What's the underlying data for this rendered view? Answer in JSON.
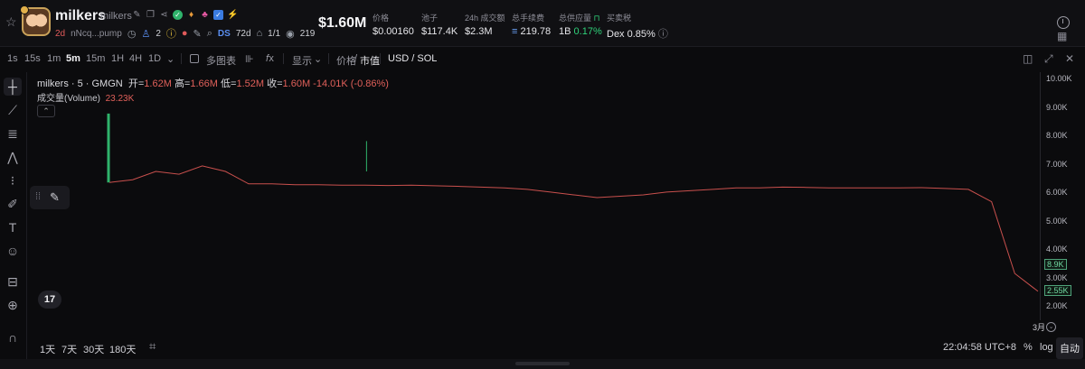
{
  "header": {
    "token_name": "milkers",
    "symbol": "milkers",
    "age": "2d",
    "creator": "nNcq...pump",
    "holders": "2",
    "ds_label": "DS",
    "ds_value": "72d",
    "ratio": "1/1",
    "views": "219",
    "market_cap": "$1.60M",
    "stats": [
      {
        "label": "价格",
        "value": "$0.00160"
      },
      {
        "label": "池子",
        "value": "$117.4K"
      },
      {
        "label": "24h 成交额",
        "value": "$2.3M"
      },
      {
        "label": "总手续费",
        "value": "219.78"
      },
      {
        "label": "总供应量",
        "value": "1B",
        "extra": "0.17%"
      },
      {
        "label": "买卖税",
        "value": "Dex 0.85%"
      }
    ]
  },
  "toolbar": {
    "intervals": [
      "1s",
      "15s",
      "1m",
      "5m",
      "15m",
      "1H",
      "4H",
      "1D"
    ],
    "active_interval": "5m",
    "multi_chart": "多图表",
    "display": "显示",
    "price_label": "价格",
    "slash": "/",
    "mcap_label": "市值",
    "currency": "USD / SOL"
  },
  "chart": {
    "legend_title": "milkers · 5 · GMGN",
    "open_label": "开=",
    "open": "1.62M",
    "high_label": "高=",
    "high": "1.66M",
    "low_label": "低=",
    "low": "1.52M",
    "close_label": "收=",
    "close": "1.60M",
    "change": "-14.01K (-0.86%)",
    "volume_label": "成交量(Volume)",
    "volume": "23.23K",
    "tv_logo": "17",
    "date_label": "3月"
  },
  "chart_data": {
    "type": "line",
    "ylim": [
      1500000,
      10500000
    ],
    "y_ticks": [
      "10.00K",
      "9.00K",
      "8.00K",
      "7.00K",
      "6.00K",
      "5.00K",
      "4.00K",
      "3.00K",
      "2.00K"
    ],
    "price_tags": [
      "8.9K",
      "2.55K"
    ],
    "x": [
      0,
      1,
      2,
      3,
      4,
      5,
      6,
      7,
      8,
      9,
      10,
      11,
      12,
      13,
      14,
      15,
      16,
      17,
      18,
      19,
      20,
      21,
      22,
      23,
      24,
      25,
      26,
      27,
      28,
      29,
      30,
      31,
      32,
      33,
      34,
      35,
      36,
      37,
      38,
      39,
      40
    ],
    "series": [
      {
        "values": [
          6500000,
          6600000,
          6900000,
          6800000,
          7100000,
          6900000,
          6450000,
          6450000,
          6420000,
          6420000,
          6400000,
          6400000,
          6390000,
          6400000,
          6380000,
          6360000,
          6330000,
          6300000,
          6250000,
          6150000,
          6050000,
          5950000,
          6000000,
          6050000,
          6150000,
          6200000,
          6250000,
          6300000,
          6300000,
          6330000,
          6320000,
          6300000,
          6300000,
          6300000,
          6300000,
          6310000,
          6280000,
          6250000,
          5800000,
          3200000,
          2550000
        ]
      }
    ]
  },
  "bottom": {
    "ranges": [
      "1天",
      "7天",
      "30天",
      "180天"
    ],
    "time": "22:04:58 UTC+8",
    "percent": "%",
    "log": "log",
    "auto": "自动"
  },
  "colors": {
    "accent_red": "#e0605a",
    "accent_green": "#2fd27a",
    "line_down": "#c9504d",
    "line_up": "#2fb36b"
  }
}
